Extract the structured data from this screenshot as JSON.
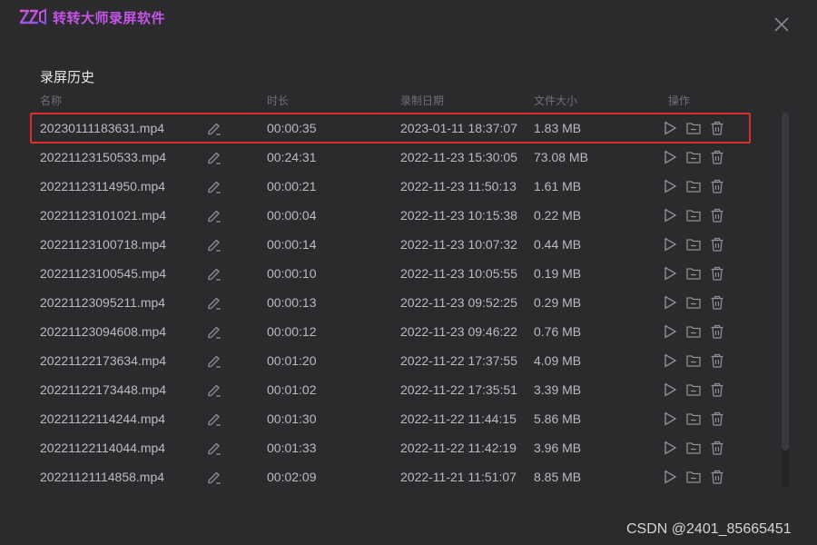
{
  "app": {
    "title": "转转大师录屏软件",
    "logo_icon": "zzds-logo-icon",
    "accent": "#c455e8"
  },
  "section_title": "录屏历史",
  "columns": {
    "name": "名称",
    "duration": "时长",
    "date": "录制日期",
    "size": "文件大小",
    "actions": "操作"
  },
  "selected_row": 0,
  "rows": [
    {
      "name": "20230111183631.mp4",
      "duration": "00:00:35",
      "date": "2023-01-11 18:37:07",
      "size": "1.83 MB"
    },
    {
      "name": "20221123150533.mp4",
      "duration": "00:24:31",
      "date": "2022-11-23 15:30:05",
      "size": "73.08 MB"
    },
    {
      "name": "20221123114950.mp4",
      "duration": "00:00:21",
      "date": "2022-11-23 11:50:13",
      "size": "1.61 MB"
    },
    {
      "name": "20221123101021.mp4",
      "duration": "00:00:04",
      "date": "2022-11-23 10:15:38",
      "size": "0.22 MB"
    },
    {
      "name": "20221123100718.mp4",
      "duration": "00:00:14",
      "date": "2022-11-23 10:07:32",
      "size": "0.44 MB"
    },
    {
      "name": "20221123100545.mp4",
      "duration": "00:00:10",
      "date": "2022-11-23 10:05:55",
      "size": "0.19 MB"
    },
    {
      "name": "20221123095211.mp4",
      "duration": "00:00:13",
      "date": "2022-11-23 09:52:25",
      "size": "0.29 MB"
    },
    {
      "name": "20221123094608.mp4",
      "duration": "00:00:12",
      "date": "2022-11-23 09:46:22",
      "size": "0.76 MB"
    },
    {
      "name": "20221122173634.mp4",
      "duration": "00:01:20",
      "date": "2022-11-22 17:37:55",
      "size": "4.09 MB"
    },
    {
      "name": "20221122173448.mp4",
      "duration": "00:01:02",
      "date": "2022-11-22 17:35:51",
      "size": "3.39 MB"
    },
    {
      "name": "20221122114244.mp4",
      "duration": "00:01:30",
      "date": "2022-11-22 11:44:15",
      "size": "5.86 MB"
    },
    {
      "name": "20221122114044.mp4",
      "duration": "00:01:33",
      "date": "2022-11-22 11:42:19",
      "size": "3.96 MB"
    },
    {
      "name": "20221121114858.mp4",
      "duration": "00:02:09",
      "date": "2022-11-21 11:51:07",
      "size": "8.85 MB"
    }
  ],
  "watermark": "CSDN @2401_85665451"
}
